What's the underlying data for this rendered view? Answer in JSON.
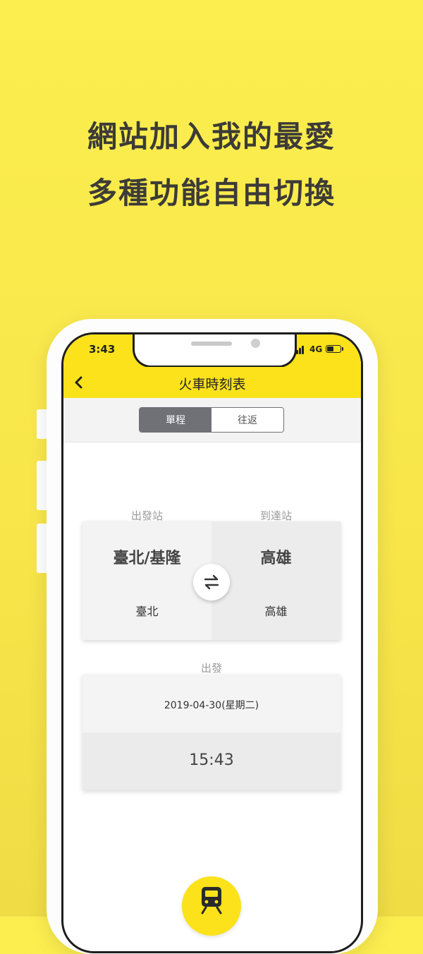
{
  "headline": {
    "line1": "網站加入我的最愛",
    "line2": "多種功能自由切換"
  },
  "status_bar": {
    "time": "3:43",
    "network": "4G",
    "battery_level": 0.5
  },
  "nav": {
    "title": "火車時刻表",
    "back_icon": "chevron-left-icon"
  },
  "trip_type": {
    "options": [
      "單程",
      "往返"
    ],
    "selected": "單程"
  },
  "labels": {
    "departure_station": "出發站",
    "arrival_station": "到達站",
    "departure": "出發"
  },
  "from": {
    "region": "臺北/基隆",
    "station": "臺北"
  },
  "to": {
    "region": "高雄",
    "station": "高雄"
  },
  "swap_icon": "swap-arrows-icon",
  "departure": {
    "date": "2019-04-30(星期二)",
    "time": "15:43"
  },
  "fab_icon": "train-icon",
  "colors": {
    "background": "#fcee4f",
    "accent": "#fbe21a",
    "segment_active": "#707177",
    "text": "#3c3b37"
  }
}
